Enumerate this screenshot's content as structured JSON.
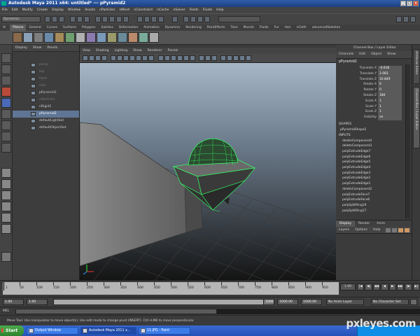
{
  "window": {
    "title": "Autodesk Maya 2011 x64: untitled*  ---  pPyramid2",
    "buttons": [
      "_",
      "□",
      "×"
    ]
  },
  "menubar": [
    "File",
    "Edit",
    "Modify",
    "Create",
    "Display",
    "Window",
    "Assets",
    "nParticles",
    "nMesh",
    "nConstraint",
    "nCache",
    "nSolver",
    "Fields",
    "Fluids",
    "Help"
  ],
  "statusline": {
    "mode": "Dynamics"
  },
  "shelf_tabs": [
    "Pilzone",
    "General",
    "Curves",
    "Surfaces",
    "Polygons",
    "Subdivs",
    "Deformation",
    "Animation",
    "Dynamics",
    "Rendering",
    "PaintEffects",
    "Toon",
    "Muscle",
    "Fluids",
    "Fur",
    "Hair",
    "nCloth",
    "advancedSkeleton"
  ],
  "outliner": {
    "menu": [
      "Display",
      "Show",
      "Panels"
    ],
    "items": [
      {
        "label": "persp",
        "dim": true
      },
      {
        "label": "top",
        "dim": true
      },
      {
        "label": "front",
        "dim": true
      },
      {
        "label": "side",
        "dim": true
      },
      {
        "label": "pPyramid1",
        "dim": false
      },
      {
        "label": "nParticle1",
        "dim": true
      },
      {
        "label": "nRigid1",
        "dim": false
      },
      {
        "label": "pPyramid2",
        "dim": false,
        "selected": true
      },
      {
        "label": "defaultLightSet",
        "dim": false
      },
      {
        "label": "defaultObjectSet",
        "dim": false
      }
    ]
  },
  "viewport": {
    "menu": [
      "View",
      "Shading",
      "Lighting",
      "Show",
      "Renderer",
      "Panels"
    ]
  },
  "channel_box": {
    "title": "Channel Box / Layer Editor",
    "menu": [
      "Channels",
      "Edit",
      "Object",
      "Show"
    ],
    "object": "pPyramid2",
    "attributes": [
      {
        "name": "Translate X",
        "value": "-0.018"
      },
      {
        "name": "Translate Y",
        "value": "2.083"
      },
      {
        "name": "Translate Z",
        "value": "10.849"
      },
      {
        "name": "Rotate X",
        "value": "0"
      },
      {
        "name": "Rotate Y",
        "value": "0"
      },
      {
        "name": "Rotate Z",
        "value": "180"
      },
      {
        "name": "Scale X",
        "value": "1"
      },
      {
        "name": "Scale Y",
        "value": "1"
      },
      {
        "name": "Scale Z",
        "value": "1"
      },
      {
        "name": "Visibility",
        "value": "on"
      }
    ],
    "shapes_header": "SHAPES",
    "shape": "pPyramidShape2",
    "inputs_header": "INPUTS",
    "inputs": [
      "deleteComponent4",
      "deleteComponent3",
      "polyExtrudeEdge7",
      "polyExtrudeEdge6",
      "polyExtrudeEdge5",
      "polyExtrudeEdge4",
      "polyExtrudeEdge3",
      "polyExtrudeEdge2",
      "polyExtrudeEdge1",
      "deleteComponent2",
      "polyExtrudeFace7",
      "polyExtrudeFace6",
      "polySplitRing10",
      "polySplitRing17"
    ]
  },
  "layer_editor": {
    "tabs": [
      "Display",
      "Render",
      "Anim"
    ],
    "menu": [
      "Layers",
      "Options",
      "Help"
    ]
  },
  "side_tabs": [
    "Attribute Editor",
    "Channel Box / Layer Editor"
  ],
  "time_slider": {
    "ticks": [
      "1",
      "50",
      "100",
      "150",
      "200",
      "250",
      "300",
      "350",
      "400",
      "450",
      "500",
      "550",
      "600",
      "650",
      "700",
      "750",
      "800",
      "850",
      "900",
      "950"
    ],
    "current_frame": "1.00",
    "playback_buttons": [
      "|◀",
      "◀|",
      "◀◀",
      "◀",
      "▶",
      "▶▶",
      "|▶",
      "▶|"
    ]
  },
  "range_slider": {
    "start": "1.00",
    "start2": "1.00",
    "end": "1000.00",
    "end2": "1000.00",
    "frame_marker": "1000",
    "anim_layer": "No Anim Layer",
    "character_set": "No Character Set"
  },
  "command_line": {
    "label": "MEL"
  },
  "help_line": "Move Tool: Use manipulator to move object(s). Use edit mode to change pivot (INSERT). Ctrl+LMB to move perpendicular.",
  "taskbar": {
    "start": "Start",
    "tasks": [
      "Output Window",
      "Autodesk Maya 2011 x...",
      "11.JPG - Paint"
    ]
  },
  "watermark": "pxleyes.com",
  "colors": {
    "selection": "#5f7595",
    "wireframe": "#33ff66",
    "taskbar": "#2452b8"
  }
}
